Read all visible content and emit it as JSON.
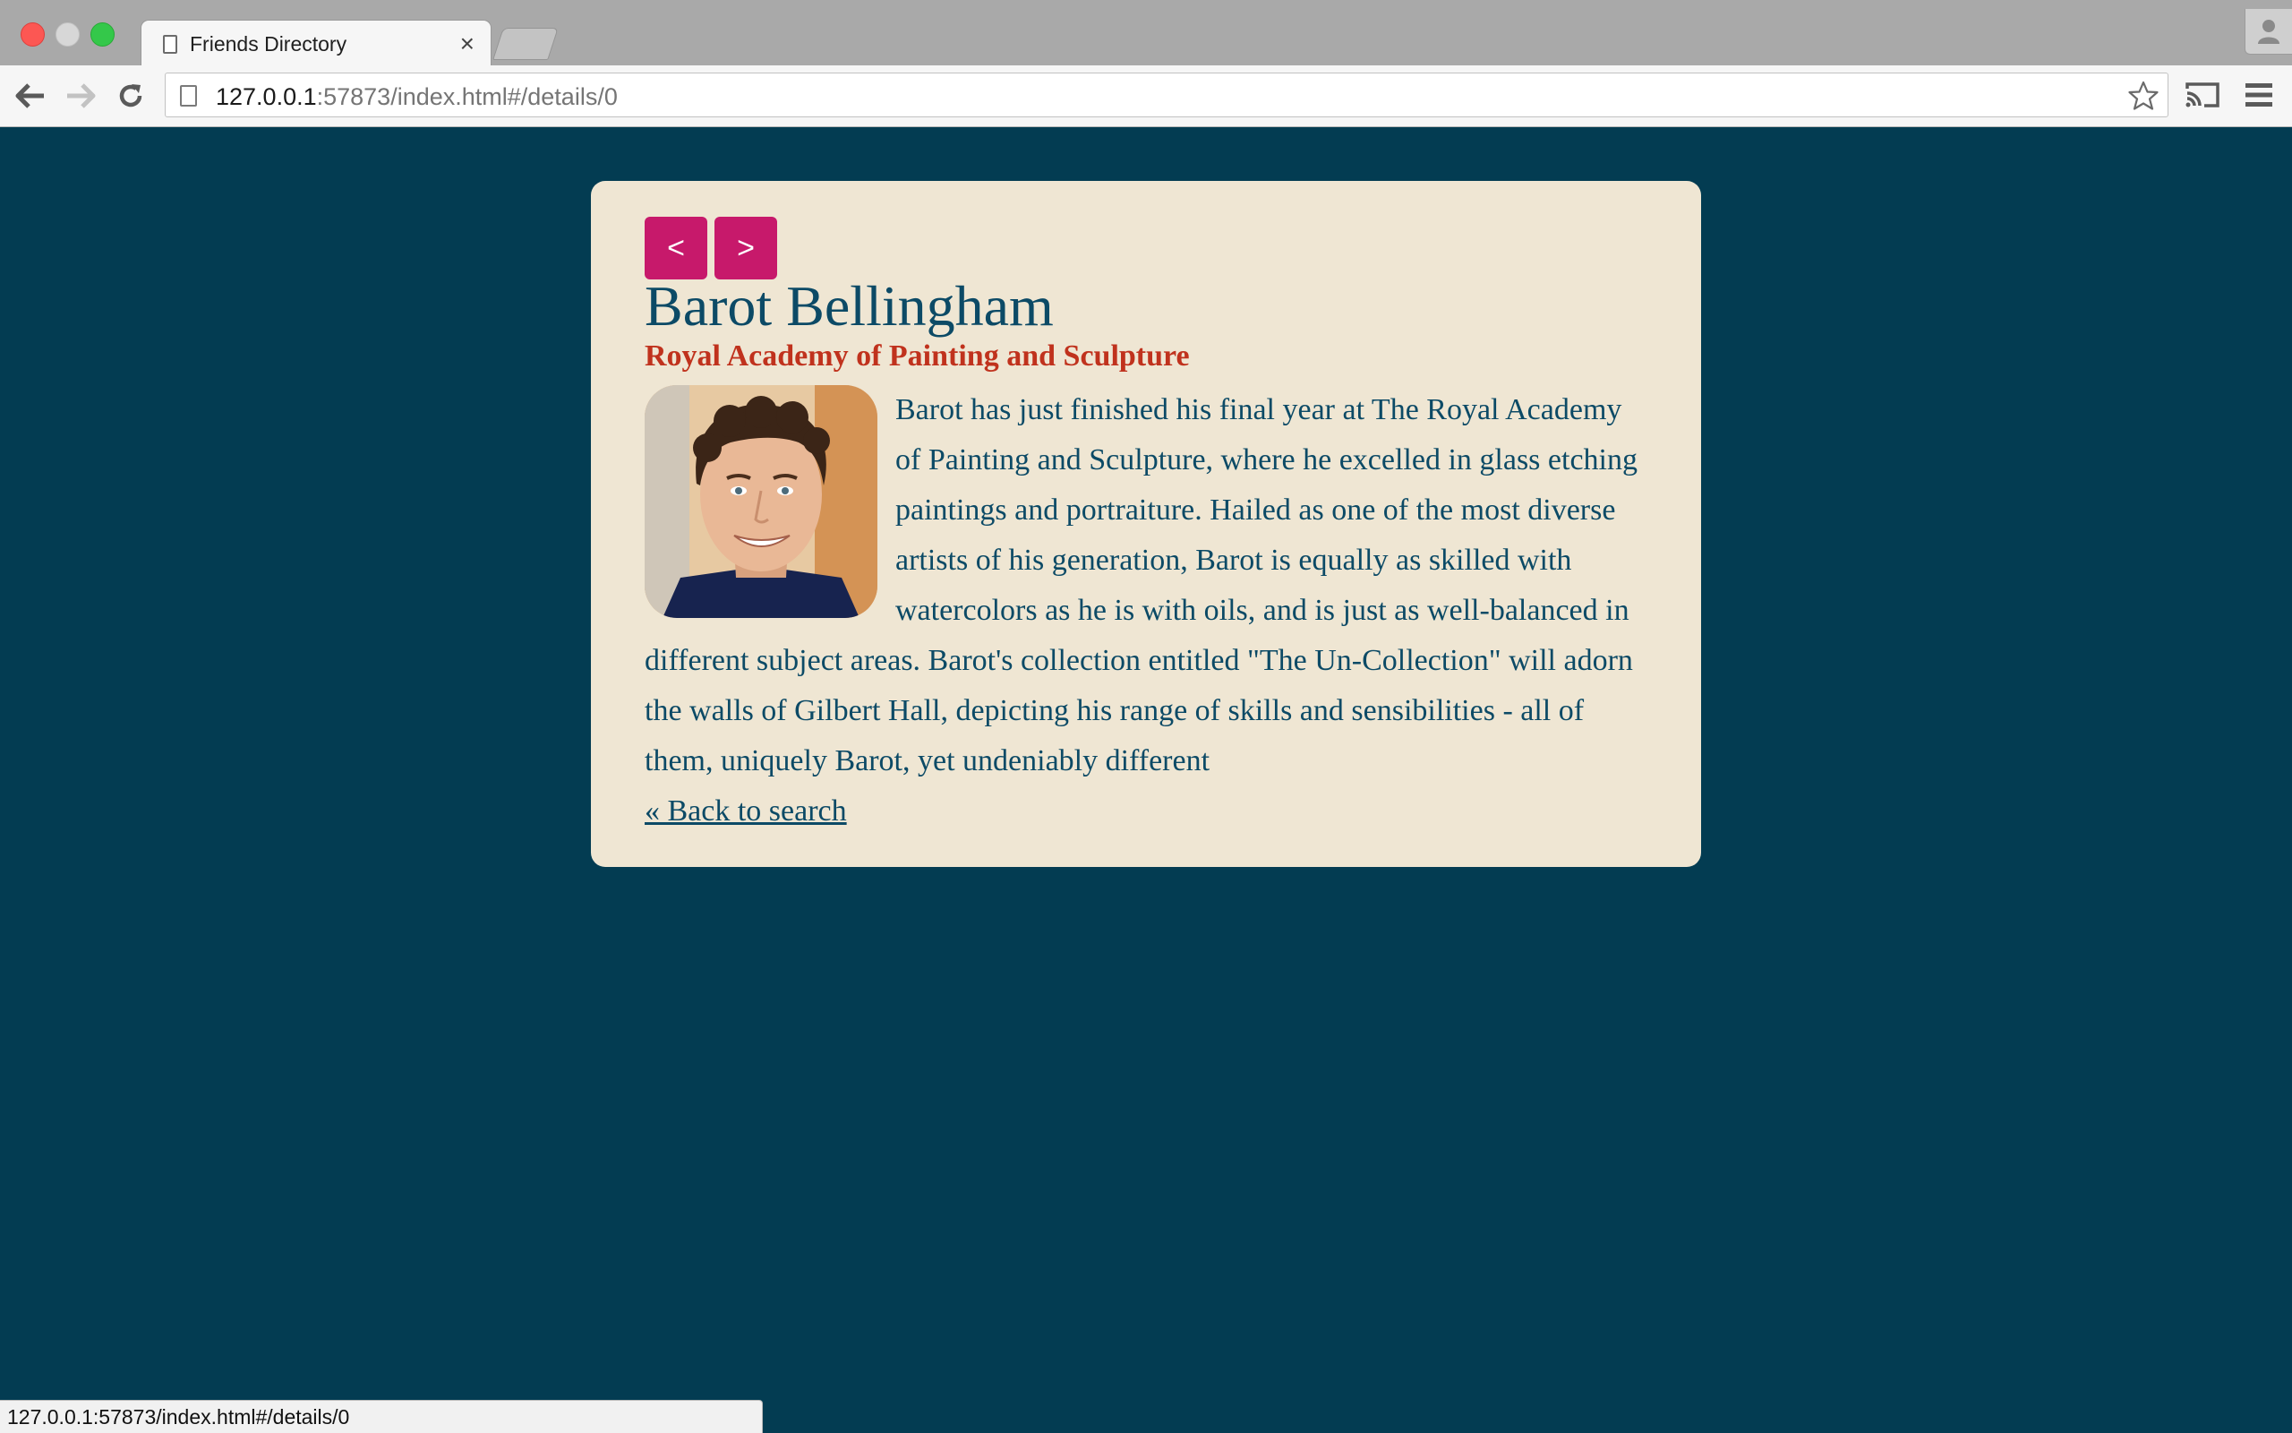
{
  "browser": {
    "tab_title": "Friends Directory",
    "tab_close": "×",
    "url_host": "127.0.0.1",
    "url_rest": ":57873/index.html#/details/0",
    "status_url": "127.0.0.1:57873/index.html#/details/0"
  },
  "pager": {
    "prev_label": "<",
    "next_label": ">"
  },
  "person": {
    "name": "Barot Bellingham",
    "school": "Royal Academy of Painting and Sculpture",
    "bio": "Barot has just finished his final year at The Royal Academy of Painting and Sculpture, where he excelled in glass etching paintings and portraiture. Hailed as one of the most diverse artists of his generation, Barot is equally as skilled with watercolors as he is with oils, and is just as well-balanced in different subject areas. Barot's collection entitled \"The Un-Collection\" will adorn the walls of Gilbert Hall, depicting his range of skills and sensibilities - all of them, uniquely Barot, yet undeniably different",
    "avatar_icon": "portrait-photo"
  },
  "back_link": "« Back to search",
  "colors": {
    "page_bg": "#033c52",
    "card_bg": "#efe6d3",
    "name": "#0c4a66",
    "school": "#c0321d",
    "button": "#c7196b"
  }
}
